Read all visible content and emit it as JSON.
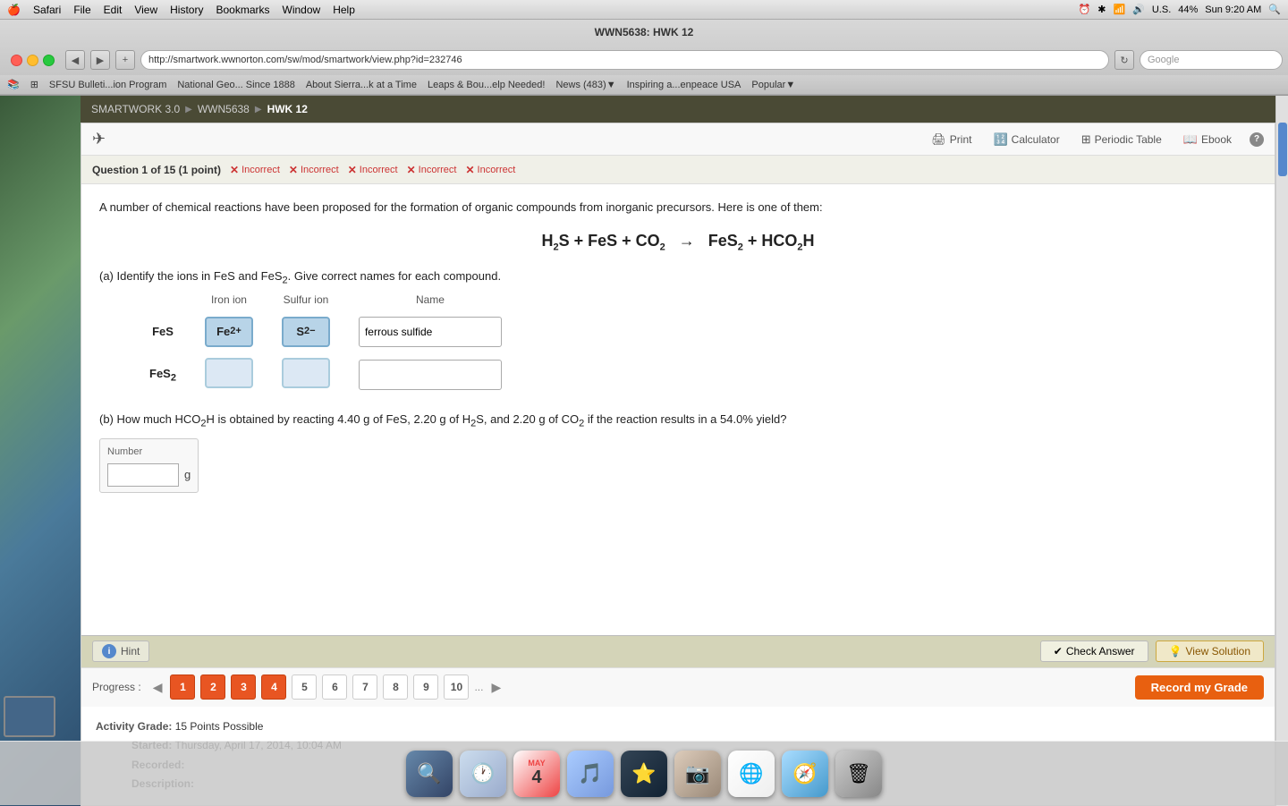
{
  "mac": {
    "title": "WWN5638: HWK 12",
    "menubar": {
      "apple": "🍎",
      "items": [
        "Safari",
        "File",
        "Edit",
        "View",
        "History",
        "Bookmarks",
        "Window",
        "Help"
      ]
    },
    "status": {
      "time": "Sun 9:20 AM",
      "battery": "44%",
      "wifi": "WiFi",
      "us": "U.S."
    }
  },
  "browser": {
    "title": "WWN5638: HWK 12",
    "url": "http://smartwork.wwnorton.com/sw/mod/smartwork/view.php?id=232746",
    "search_placeholder": "Google",
    "bookmarks": [
      "SFSU Bulleti...ion Program",
      "National Geo... Since 1888",
      "About Sierra...k at a Time",
      "Leaps & Bou...elp Needed!",
      "News (483)▼",
      "Inspiring a...enpeace USA",
      "Popular▼"
    ]
  },
  "breadcrumb": {
    "items": [
      "SMARTWORK 3.0",
      "WWN5638",
      "HWK 12"
    ]
  },
  "toolbar": {
    "print": "Print",
    "calculator": "Calculator",
    "periodic_table": "Periodic Table",
    "ebook": "Ebook"
  },
  "question": {
    "label": "Question 1 of 15 (1 point)",
    "attempts": [
      "Incorrect",
      "Incorrect",
      "Incorrect",
      "Incorrect",
      "Incorrect"
    ],
    "text1": "A number of chemical reactions have been proposed for the formation of organic compounds from inorganic precursors. Here is one of them:",
    "equation": "H₂S + FeS + CO₂  →  FeS₂ + HCO₂H",
    "part_a_label": "(a) Identify the ions in FeS and FeS₂. Give correct names for each compound.",
    "col_iron": "Iron ion",
    "col_sulfur": "Sulfur ion",
    "col_name": "Name",
    "row1_label": "FeS",
    "row1_iron": "Fe²⁺",
    "row1_sulfur": "S²⁻",
    "row1_name": "ferrous sulfide",
    "row2_label": "FeS₂",
    "row2_iron": "",
    "row2_sulfur": "",
    "row2_name": "",
    "part_b_label": "(b) How much HCO₂H is obtained by reacting 4.40 g of FeS, 2.20 g of H₂S, and 2.20 g of CO₂ if the reaction results in a 54.0% yield?",
    "number_label": "Number",
    "unit": "g"
  },
  "buttons": {
    "hint": "Hint",
    "check_answer": "Check Answer",
    "view_solution": "View Solution",
    "record_grade": "Record my Grade"
  },
  "progress": {
    "label": "Progress :",
    "pages": [
      "1",
      "2",
      "3",
      "4",
      "5",
      "6",
      "7",
      "8",
      "9",
      "10"
    ],
    "active": [
      0,
      1,
      2,
      3
    ],
    "dots": "..."
  },
  "activity": {
    "grade_label": "Activity Grade:",
    "grade_value": "15 Points Possible",
    "started_label": "Started:",
    "started_value": "Thursday, April 17, 2014, 10:04 AM",
    "recorded_label": "Recorded:",
    "recorded_value": "",
    "description_label": "Description:",
    "description_value": ""
  }
}
